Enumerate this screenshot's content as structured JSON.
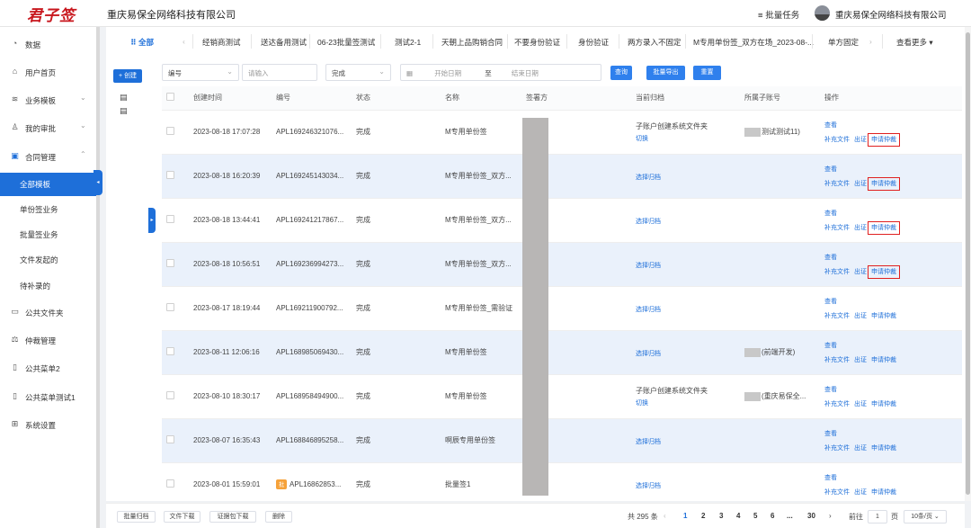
{
  "header": {
    "logo_text": "君子签",
    "company": "重庆易保全网络科技有限公司",
    "batch_task": "批量任务",
    "user_name": "重庆易保全网络科技有限公司"
  },
  "sidebar": {
    "items": [
      {
        "label": "数据",
        "icon": "dashboard-icon"
      },
      {
        "label": "用户首页",
        "icon": "home-icon"
      },
      {
        "label": "业务模板",
        "icon": "layers-icon"
      },
      {
        "label": "我的审批",
        "icon": "approval-icon"
      },
      {
        "label": "合同管理",
        "icon": "contract-icon"
      },
      {
        "label": "全部模板",
        "active": true
      },
      {
        "label": "单份签业务"
      },
      {
        "label": "批量签业务"
      },
      {
        "label": "文件发起的"
      },
      {
        "label": "待补录的"
      },
      {
        "label": "公共文件夹",
        "icon": "folder-icon"
      },
      {
        "label": "仲裁管理",
        "icon": "scale-icon"
      },
      {
        "label": "公共菜单2",
        "icon": "doc-icon"
      },
      {
        "label": "公共菜单测试1",
        "icon": "doc-icon"
      },
      {
        "label": "系统设置",
        "icon": "grid-icon"
      }
    ]
  },
  "tabs": {
    "all": "全部",
    "items": [
      "经销商测试",
      "送达备用测试",
      "06-23批量签测试",
      "测试2-1",
      "天朝上品购销合同",
      "不要身份验证",
      "身份验证",
      "两方录入不固定",
      "M专用单份签_双方在场_2023-08-...",
      "单方固定"
    ],
    "more": "查看更多"
  },
  "toolbar": {
    "create": "+ 创建",
    "field_select": "编号",
    "field_placeholder": "请输入",
    "status_select": "完成",
    "start_date": "开始日期",
    "to": "至",
    "end_date": "结束日期",
    "query": "查询",
    "batch_export": "批量导出",
    "reset": "重置"
  },
  "table": {
    "headers": [
      "创建时间",
      "编号",
      "状态",
      "名称",
      "签署方",
      "当前归档",
      "所属子账号",
      "操作"
    ],
    "rows": [
      {
        "time": "2023-08-18 17:07:28",
        "no": "APL169246321076...",
        "status": "完成",
        "name": "M专用单份签",
        "archive": "子账户创建系统文件夹",
        "archive_link": "切换",
        "sub": "测试测试11)"
      },
      {
        "time": "2023-08-18 16:20:39",
        "no": "APL169245143034...",
        "status": "完成",
        "name": "M专用单份签_双方...",
        "archive": "",
        "archive_link": "选择归档",
        "sub": ""
      },
      {
        "time": "2023-08-18 13:44:41",
        "no": "APL169241217867...",
        "status": "完成",
        "name": "M专用单份签_双方...",
        "archive": "",
        "archive_link": "选择归档",
        "sub": ""
      },
      {
        "time": "2023-08-18 10:56:51",
        "no": "APL169236994273...",
        "status": "完成",
        "name": "M专用单份签_双方...",
        "archive": "",
        "archive_link": "选择归档",
        "sub": ""
      },
      {
        "time": "2023-08-17 18:19:44",
        "no": "APL169211900792...",
        "status": "完成",
        "name": "M专用单份签_需验证",
        "archive": "",
        "archive_link": "选择归档",
        "sub": ""
      },
      {
        "time": "2023-08-11 12:06:16",
        "no": "APL168985069430...",
        "status": "完成",
        "name": "M专用单份签",
        "archive": "",
        "archive_link": "选择归档",
        "sub": "(前端开发)"
      },
      {
        "time": "2023-08-10 18:30:17",
        "no": "APL168958494900...",
        "status": "完成",
        "name": "M专用单份签",
        "archive": "子账户创建系统文件夹",
        "archive_link": "切换",
        "sub": "(重庆易保全..."
      },
      {
        "time": "2023-08-07 16:35:43",
        "no": "APL168846895258...",
        "status": "完成",
        "name": "啊辰专用单份签",
        "archive": "",
        "archive_link": "选择归档",
        "sub": ""
      },
      {
        "time": "2023-08-01 15:59:01",
        "no": "APL16862853...",
        "tag": "批",
        "status": "完成",
        "name": "批量签1",
        "archive": "",
        "archive_link": "选择归档",
        "sub": ""
      }
    ],
    "op_view": "查看",
    "op_supplement": "补充文件",
    "op_evidence": "出证",
    "op_arbitration": "申请仲裁"
  },
  "bottom": {
    "batch_archive": "批量归档",
    "file_download": "文件下载",
    "evidence_download": "证据包下载",
    "delete": "删除",
    "total": "共 295 条",
    "pages": [
      "1",
      "2",
      "3",
      "4",
      "5",
      "6",
      "...",
      "30"
    ],
    "goto": "前往",
    "goto_value": "1",
    "page_unit": "页",
    "page_size": "10条/页"
  }
}
